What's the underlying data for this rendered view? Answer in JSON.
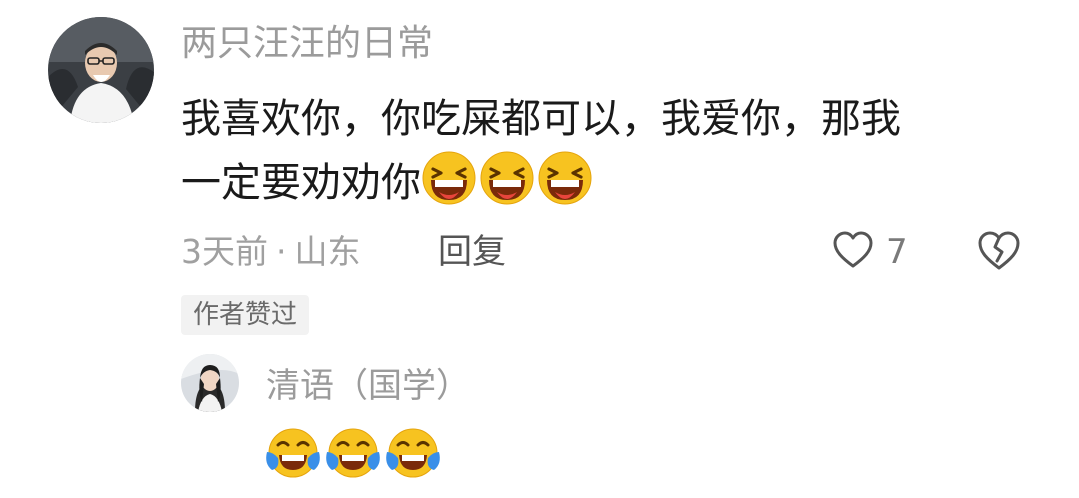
{
  "comment": {
    "username": "两只汪汪的日常",
    "text_line1": "我喜欢你，你吃屎都可以，我爱你，那我",
    "text_line2": "一定要劝劝你",
    "emojis": [
      "laughing-emoji",
      "laughing-emoji",
      "laughing-emoji"
    ],
    "time": "3天前",
    "separator": "·",
    "location": "山东",
    "reply_label": "回复",
    "like_count": "7",
    "author_badge": "作者赞过"
  },
  "reply": {
    "username": "清语（国学）",
    "emojis": [
      "tears-of-joy-emoji",
      "tears-of-joy-emoji",
      "tears-of-joy-emoji"
    ]
  },
  "colors": {
    "username": "#9b9b9b",
    "text": "#1a1a1a",
    "meta": "#a0a0a0",
    "emoji_yellow": "#f7c320",
    "emoji_tear": "#3a8fe8"
  }
}
